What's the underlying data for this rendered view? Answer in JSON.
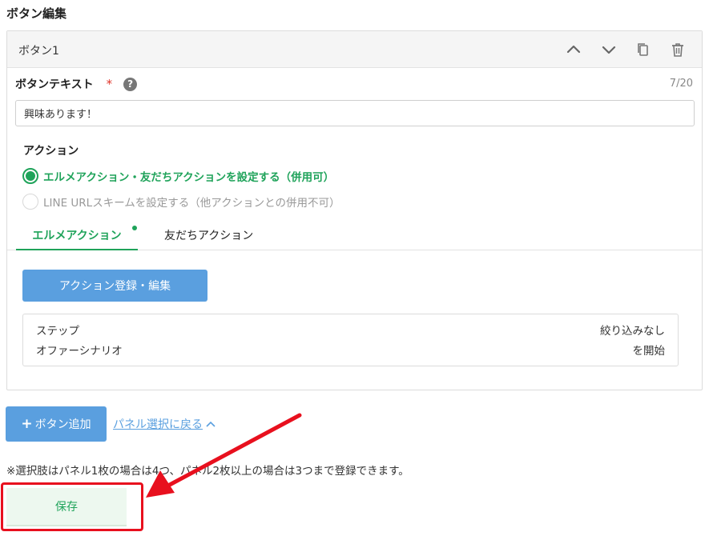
{
  "section_title": "ボタン編集",
  "panel": {
    "title": "ボタン1",
    "icons": [
      "chevron-up-icon",
      "chevron-down-icon",
      "copy-icon",
      "trash-icon"
    ]
  },
  "button_text": {
    "label": "ボタンテキスト",
    "required_mark": "*",
    "help_mark": "?",
    "counter": "7/20",
    "value": "興味あります！"
  },
  "action": {
    "label": "アクション",
    "options": [
      {
        "label": "エルメアクション・友だちアクションを設定する（併用可）",
        "selected": true
      },
      {
        "label": "LINE URLスキームを設定する（他アクションとの併用不可）",
        "selected": false
      }
    ],
    "tabs": [
      {
        "label": "エルメアクション",
        "active": true
      },
      {
        "label": "友だちアクション",
        "active": false
      }
    ],
    "edit_button": "アクション登録・編集",
    "summary": [
      {
        "left": "ステップ",
        "right": "絞り込みなし"
      },
      {
        "left": "オファーシナリオ",
        "right": "を開始"
      }
    ]
  },
  "footer": {
    "add_plus": "+",
    "add_button": "ボタン追加",
    "back_link": "パネル選択に戻る",
    "note": "※選択肢はパネル1枚の場合は4つ、パネル2枚以上の場合は3つまで登録できます。",
    "save_button": "保存"
  },
  "colors": {
    "accent_green": "#1fa35a",
    "button_blue": "#5a9fdf",
    "annotation_red": "#e8101e"
  }
}
